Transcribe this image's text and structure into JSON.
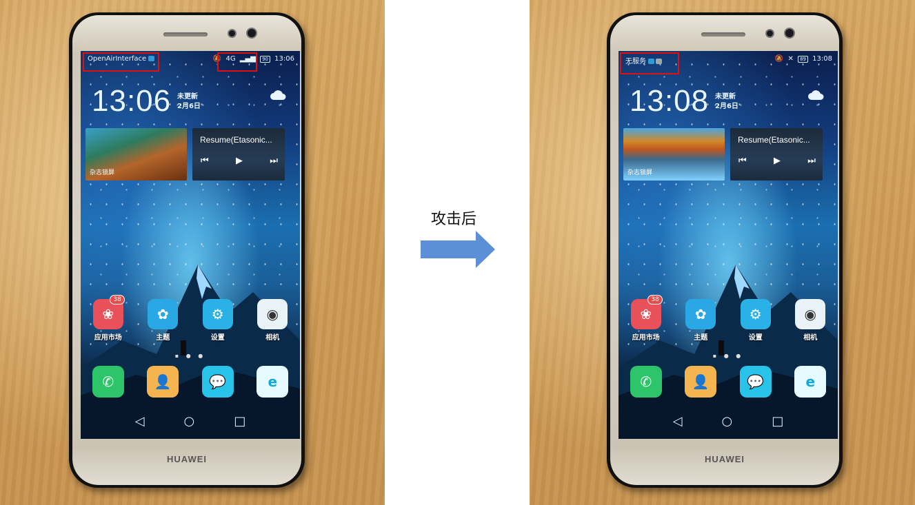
{
  "before": {
    "status": {
      "carrier": "OpenAirInterface",
      "network": "4G",
      "battery": "90",
      "time": "13:06"
    },
    "clock": {
      "time": "13:06",
      "update": "未更新",
      "date": "2月6日"
    },
    "widgets": {
      "magazine": "杂志锁屏",
      "music_title": "Resume(Etasonic..."
    },
    "apps": [
      {
        "name": "应用市场",
        "badge": "38",
        "icon": "huawei-appgallery-icon"
      },
      {
        "name": "主题",
        "icon": "themes-icon"
      },
      {
        "name": "设置",
        "icon": "settings-gear-icon"
      },
      {
        "name": "相机",
        "icon": "camera-icon"
      }
    ]
  },
  "after": {
    "status": {
      "carrier": "无服务",
      "battery": "89",
      "time": "13:08"
    },
    "clock": {
      "time": "13:08",
      "update": "未更新",
      "date": "2月6日"
    },
    "widgets": {
      "magazine": "杂志锁屏",
      "music_title": "Resume(Etasonic..."
    },
    "apps": [
      {
        "name": "应用市场",
        "badge": "38",
        "icon": "huawei-appgallery-icon"
      },
      {
        "name": "主题",
        "icon": "themes-icon"
      },
      {
        "name": "设置",
        "icon": "settings-gear-icon"
      },
      {
        "name": "相机",
        "icon": "camera-icon"
      }
    ]
  },
  "dock": [
    "phone-icon",
    "contacts-icon",
    "messages-icon",
    "browser-icon"
  ],
  "device_brand": "HUAWEI",
  "transition_label": "攻击后",
  "colors": {
    "highlight_box": "#e01010",
    "arrow": "#5b8fd6"
  }
}
